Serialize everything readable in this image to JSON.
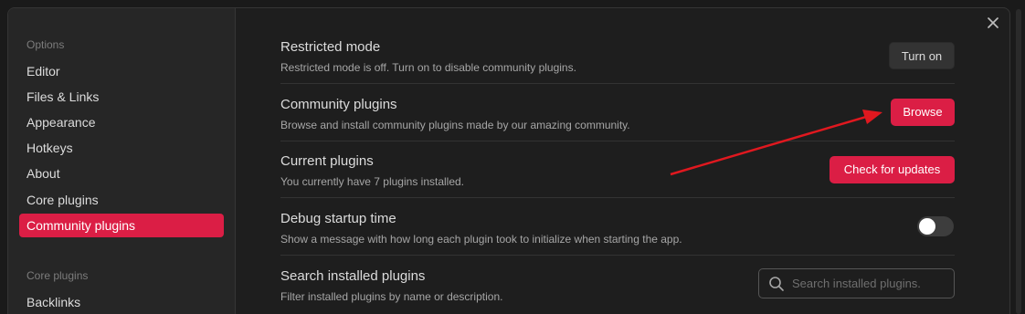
{
  "sidebar": {
    "options_heading": "Options",
    "options_items": [
      {
        "label": "Editor"
      },
      {
        "label": "Files & Links"
      },
      {
        "label": "Appearance"
      },
      {
        "label": "Hotkeys"
      },
      {
        "label": "About"
      },
      {
        "label": "Core plugins"
      },
      {
        "label": "Community plugins",
        "active": true
      }
    ],
    "core_heading": "Core plugins",
    "core_items": [
      {
        "label": "Backlinks"
      }
    ]
  },
  "settings": {
    "restricted_mode": {
      "name": "Restricted mode",
      "description": "Restricted mode is off. Turn on to disable community plugins.",
      "button_label": "Turn on"
    },
    "community_plugins": {
      "name": "Community plugins",
      "description": "Browse and install community plugins made by our amazing community.",
      "button_label": "Browse"
    },
    "current_plugins": {
      "name": "Current plugins",
      "description": "You currently have 7 plugins installed.",
      "button_label": "Check for updates"
    },
    "debug_startup": {
      "name": "Debug startup time",
      "description": "Show a message with how long each plugin took to initialize when starting the app.",
      "toggle_on": false
    },
    "search_plugins": {
      "name": "Search installed plugins",
      "description": "Filter installed plugins by name or description.",
      "placeholder": "Search installed plugins."
    }
  },
  "colors": {
    "accent": "#db1e45",
    "annotation_arrow": "#e0181f",
    "background": "#1e1e1e",
    "sidebar_background": "#262626"
  },
  "icons": {
    "close": "close-icon",
    "search": "search-icon"
  }
}
